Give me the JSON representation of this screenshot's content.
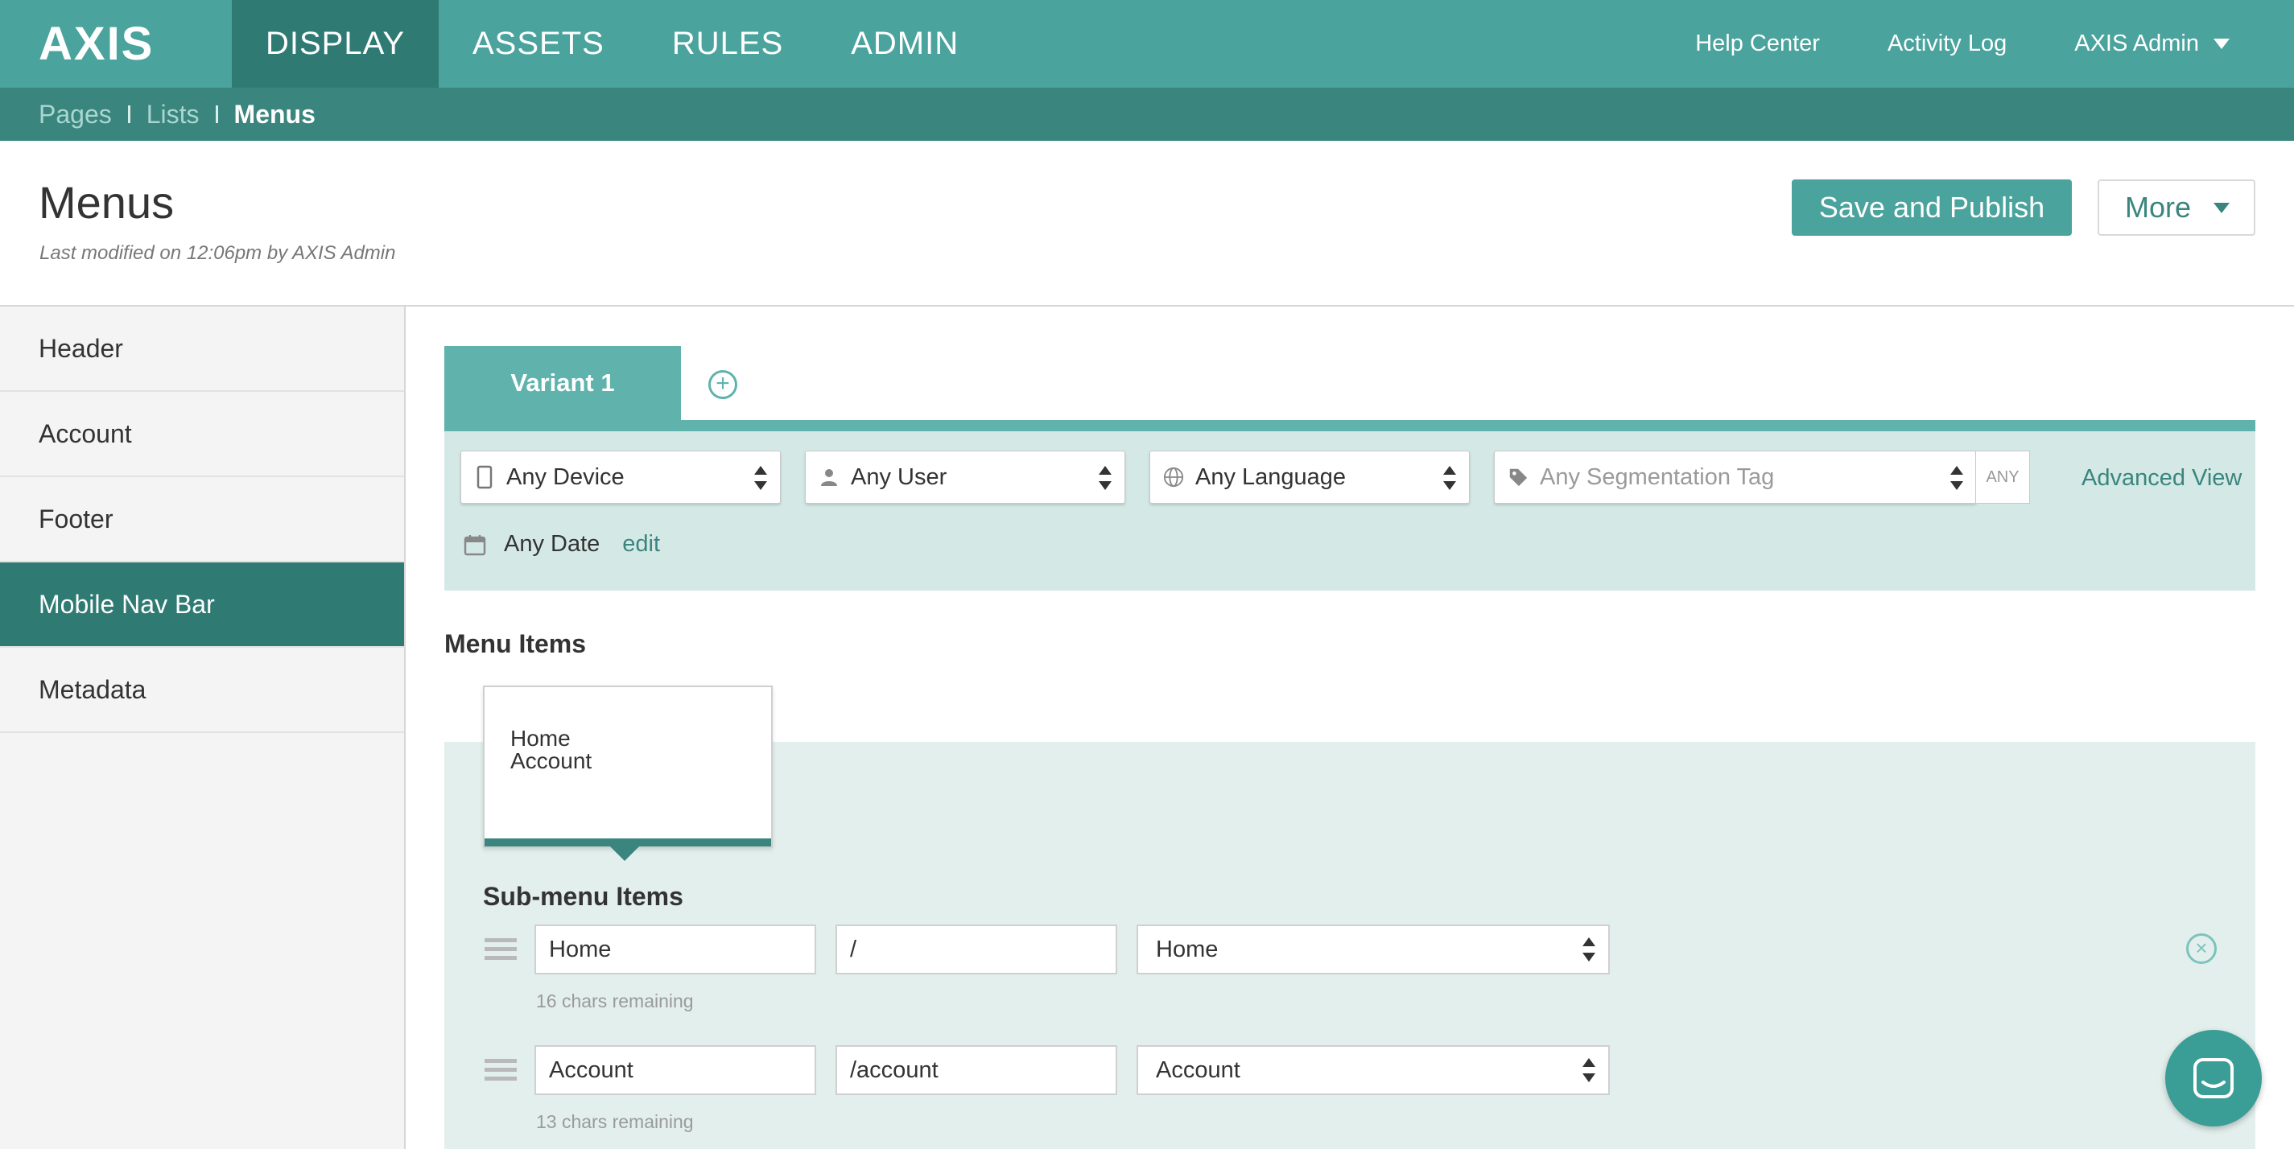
{
  "app": {
    "logo": "AXIS",
    "nav": [
      "DISPLAY",
      "ASSETS",
      "RULES",
      "ADMIN"
    ],
    "active_nav": "DISPLAY",
    "top_links": {
      "help": "Help Center",
      "activity": "Activity Log",
      "user": "AXIS Admin"
    }
  },
  "breadcrumb": [
    "Pages",
    "Lists",
    "Menus"
  ],
  "header": {
    "title": "Menus",
    "subtitle": "Last modified on 12:06pm by AXIS Admin",
    "save_label": "Save and Publish",
    "more_label": "More"
  },
  "sidebar": {
    "items": [
      {
        "label": "Header",
        "active": false
      },
      {
        "label": "Account",
        "active": false
      },
      {
        "label": "Footer",
        "active": false
      },
      {
        "label": "Mobile Nav Bar",
        "active": true
      },
      {
        "label": "Metadata",
        "active": false
      }
    ]
  },
  "variants": {
    "tab_label": "Variant 1",
    "add_symbol": "+"
  },
  "filters": {
    "device": "Any Device",
    "user": "Any User",
    "language": "Any Language",
    "segmentation_placeholder": "Any Segmentation Tag",
    "any_tag": "ANY",
    "advanced_view": "Advanced View",
    "date": "Any Date",
    "date_edit": "edit"
  },
  "menu_items": {
    "title": "Menu Items",
    "list": [
      "Home",
      "Account"
    ]
  },
  "submenu": {
    "title": "Sub-menu Items",
    "rows": [
      {
        "name": "Home",
        "path": "/",
        "target": "Home",
        "hint": "16 chars remaining"
      },
      {
        "name": "Account",
        "path": "/account",
        "target": "Account",
        "hint": "13 chars remaining"
      }
    ]
  },
  "colors": {
    "brand": "#4aa39c",
    "brand_dark": "#2f7b73",
    "breadcrumb_bg": "#3a857e",
    "panel_bg": "#d4e9e6"
  }
}
